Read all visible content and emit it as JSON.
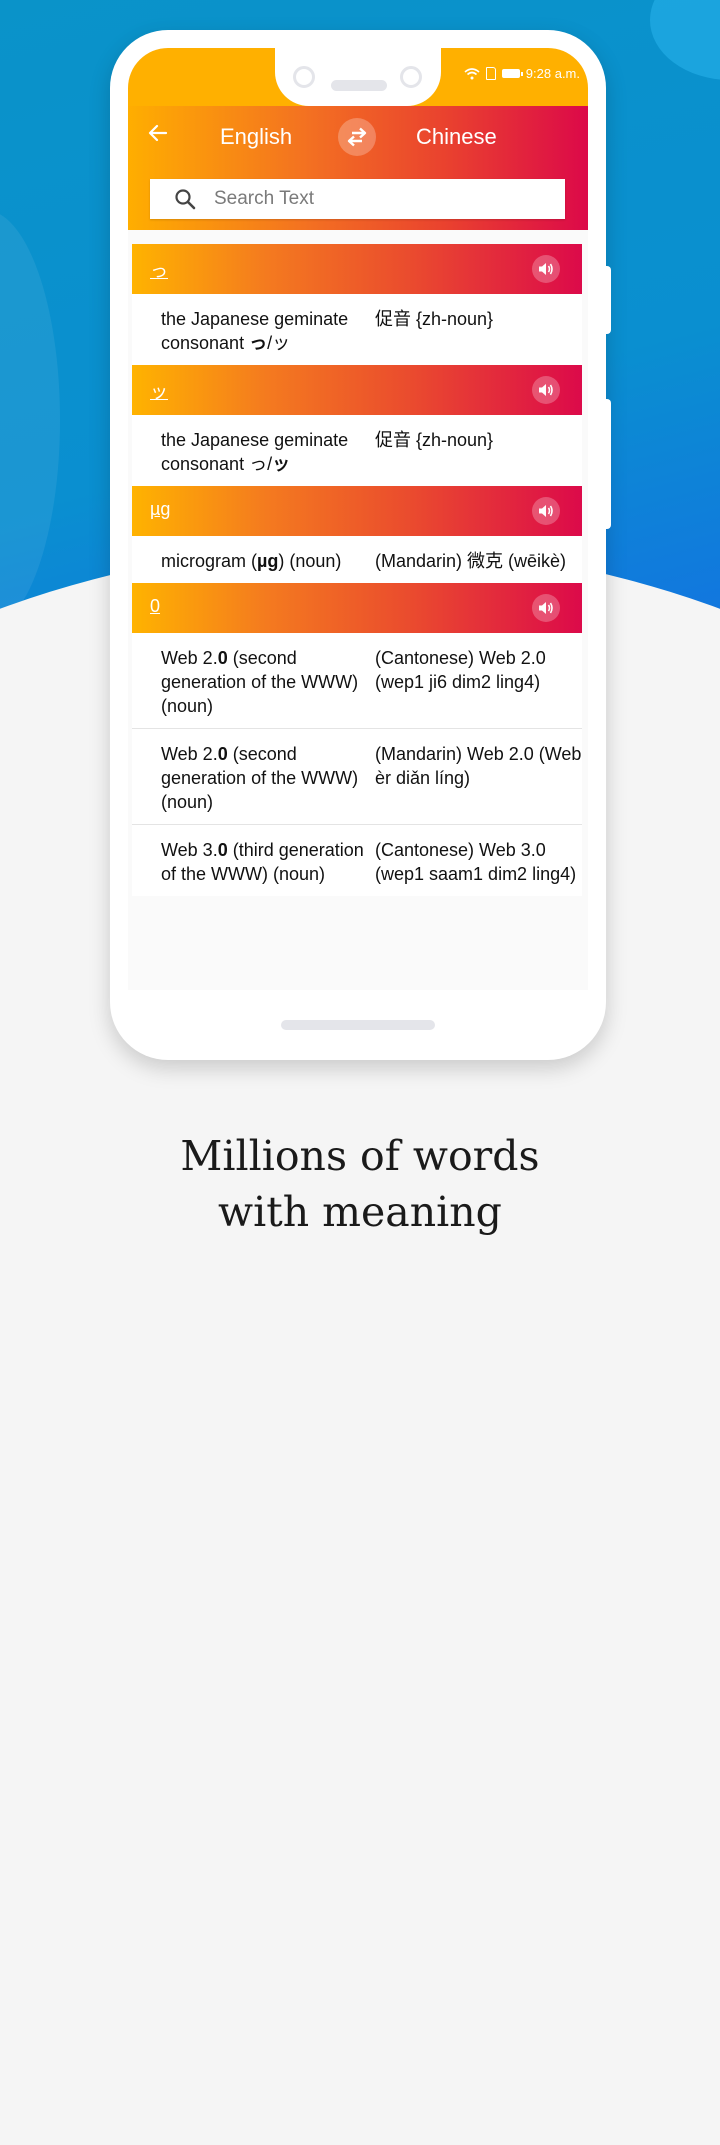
{
  "status_bar": {
    "time": "9:28 a.m.",
    "icons": [
      "wifi-icon",
      "sim-icon",
      "battery-icon"
    ]
  },
  "header": {
    "back_icon": "arrow-left-icon",
    "source_language": "English",
    "swap_icon": "swap-arrows-icon",
    "target_language": "Chinese"
  },
  "search": {
    "placeholder": "Search Text",
    "value": "",
    "icon": "search-icon"
  },
  "colors": {
    "status_bar": "#ffb000",
    "gradient_start": "#ffb300",
    "gradient_end": "#dc0a4a",
    "background_blue": "#1470e3"
  },
  "entries": [
    {
      "word": "っ",
      "rows": [
        {
          "en_pre": "the Japanese geminate consonant ",
          "en_bold": "っ",
          "en_post": "/ッ",
          "zh": "促音 {zh-noun}"
        }
      ]
    },
    {
      "word": "ッ",
      "rows": [
        {
          "en_pre": "the Japanese geminate consonant っ/",
          "en_bold": "ッ",
          "en_post": "",
          "zh": "促音 {zh-noun}"
        }
      ]
    },
    {
      "word": "µg",
      "rows": [
        {
          "en_pre": "microgram (",
          "en_bold": "µg",
          "en_post": ") (noun)",
          "zh": "(Mandarin) 微克 (wēikè)"
        }
      ]
    },
    {
      "word": "0",
      "rows": [
        {
          "en_pre": "Web 2.",
          "en_bold": "0",
          "en_post": " (second generation of the WWW) (noun)",
          "zh": "(Cantonese) Web 2.0 (wep1 ji6 dim2 ling4)"
        },
        {
          "en_pre": "Web 2.",
          "en_bold": "0",
          "en_post": " (second generation of the WWW) (noun)",
          "zh": "(Mandarin) Web 2.0 (Web èr diǎn líng)"
        },
        {
          "en_pre": "Web 3.",
          "en_bold": "0",
          "en_post": " (third generation of the WWW) (noun)",
          "zh": "(Cantonese) Web 3.0 (wep1 saam1 dim2 ling4)"
        }
      ]
    }
  ],
  "caption": {
    "line1": "Millions of words",
    "line2": "with meaning"
  }
}
